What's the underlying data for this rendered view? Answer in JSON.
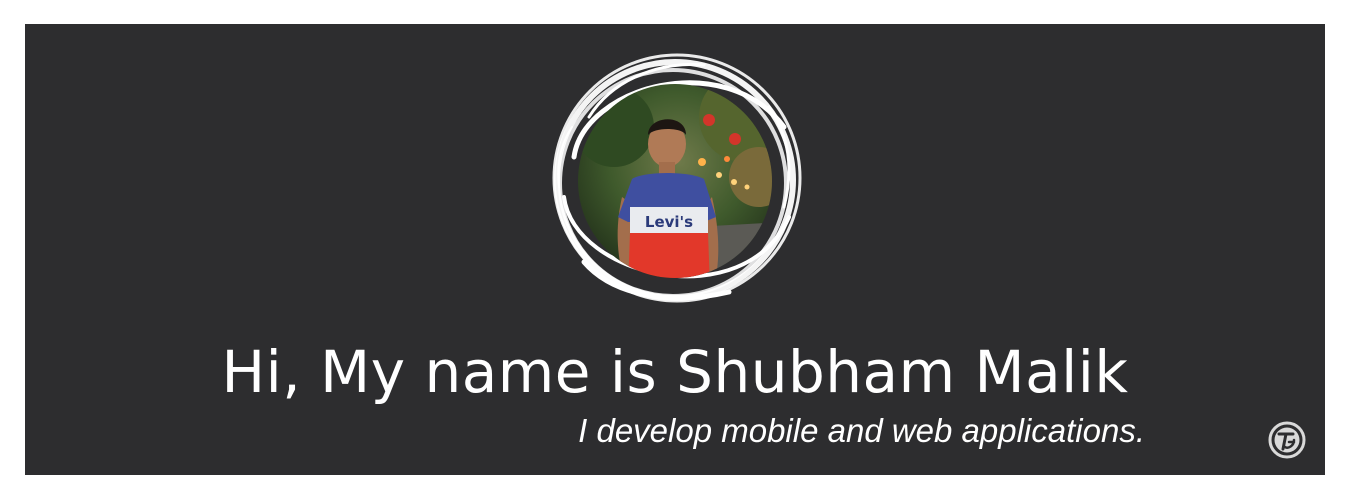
{
  "banner": {
    "headline": "Hi, My name is Shubham Malik",
    "tagline": "I develop mobile and web applications.",
    "background_color": "#2d2d2f",
    "text_color": "#ffffff"
  },
  "avatar": {
    "shirt_text": "Levi's",
    "frame_style": "white-brush-circle"
  },
  "logo": {
    "icon": "tg-monogram-icon",
    "text": "TG"
  }
}
